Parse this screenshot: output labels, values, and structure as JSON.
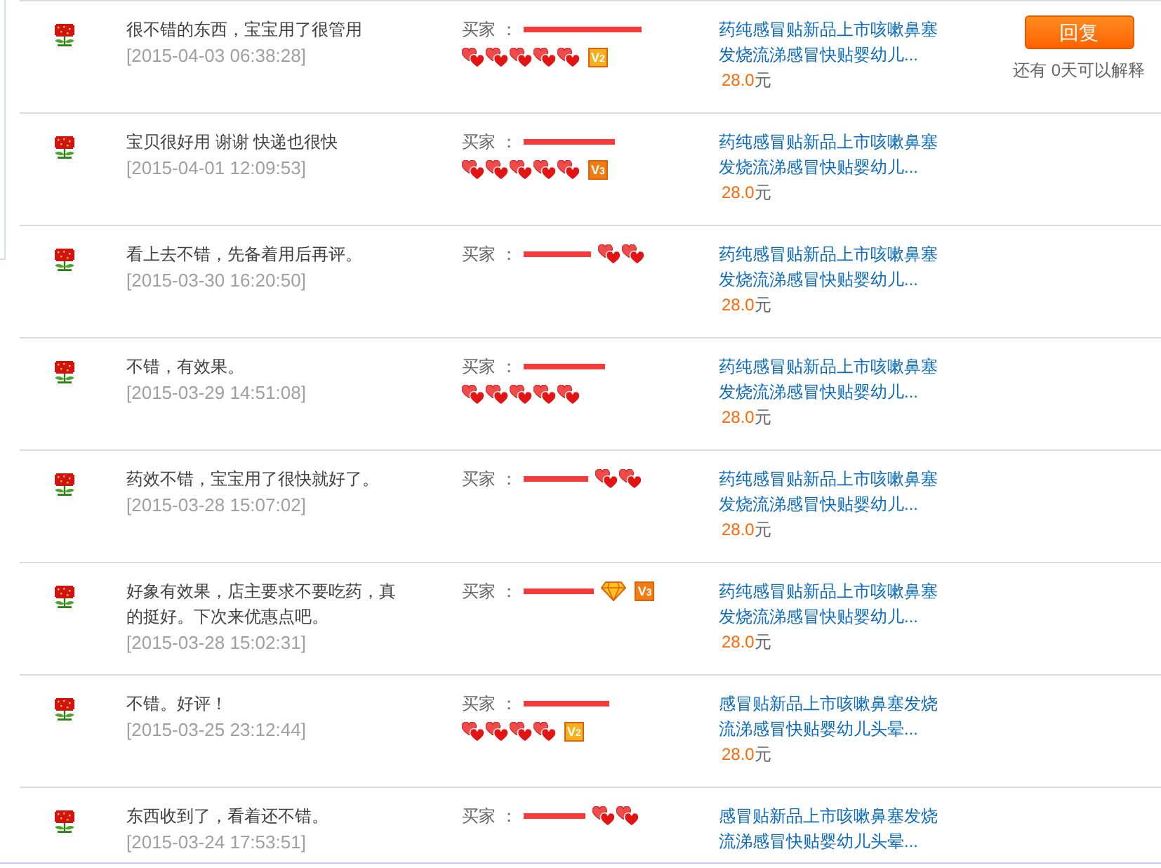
{
  "reviews": [
    {
      "comment": "很不错的东西，宝宝用了很管用",
      "date": "[2015-04-03 06:38:28]",
      "buyer_label": "买家 ：",
      "badges": [
        {
          "kind": "heart"
        },
        {
          "kind": "heart"
        },
        {
          "kind": "heart"
        },
        {
          "kind": "heart"
        },
        {
          "kind": "heart"
        }
      ],
      "vip": {
        "label": "V$_{2}$",
        "color": "#f6b01e"
      },
      "product": "药纯感冒贴新品上市咳嗽鼻塞发烧流涕感冒快贴婴幼儿...",
      "price": "28.0",
      "currency": "元",
      "reply": {
        "button": "回复",
        "note": "还有 0天可以解释"
      }
    },
    {
      "comment": "宝贝很好用 谢谢 快递也很快",
      "date": "[2015-04-01 12:09:53]",
      "buyer_label": "买家 ：",
      "badges": [
        {
          "kind": "heart"
        },
        {
          "kind": "heart"
        },
        {
          "kind": "heart"
        },
        {
          "kind": "heart"
        },
        {
          "kind": "heart"
        }
      ],
      "vip": {
        "label": "V$_{3}$",
        "color": "#f07c12"
      },
      "product": "药纯感冒贴新品上市咳嗽鼻塞发烧流涕感冒快贴婴幼儿...",
      "price": "28.0",
      "currency": "元"
    },
    {
      "comment": "看上去不错，先备着用后再评。",
      "date": "[2015-03-30 16:20:50]",
      "buyer_label": "买家 ：",
      "badges": [
        {
          "kind": "heart"
        },
        {
          "kind": "heart"
        }
      ],
      "product": "药纯感冒贴新品上市咳嗽鼻塞发烧流涕感冒快贴婴幼儿...",
      "price": "28.0",
      "currency": "元"
    },
    {
      "comment": "不错，有效果。",
      "date": "[2015-03-29 14:51:08]",
      "buyer_label": "买家 ：",
      "badges": [
        {
          "kind": "heart"
        },
        {
          "kind": "heart"
        },
        {
          "kind": "heart"
        },
        {
          "kind": "heart"
        },
        {
          "kind": "heart"
        }
      ],
      "product": "药纯感冒贴新品上市咳嗽鼻塞发烧流涕感冒快贴婴幼儿...",
      "price": "28.0",
      "currency": "元"
    },
    {
      "comment": "药效不错，宝宝用了很快就好了。",
      "date": "[2015-03-28 15:07:02]",
      "buyer_label": "买家 ：",
      "badges": [
        {
          "kind": "heart"
        },
        {
          "kind": "heart"
        }
      ],
      "product": "药纯感冒贴新品上市咳嗽鼻塞发烧流涕感冒快贴婴幼儿...",
      "price": "28.0",
      "currency": "元"
    },
    {
      "comment": "好象有效果，店主要求不要吃药，真的挺好。下次来优惠点吧。",
      "date": "[2015-03-28 15:02:31]",
      "buyer_label": "买家 ：",
      "badges": [
        {
          "kind": "diamond"
        }
      ],
      "vip": {
        "label": "V$_{3}$",
        "color": "#f07c12"
      },
      "product": "药纯感冒贴新品上市咳嗽鼻塞发烧流涕感冒快贴婴幼儿...",
      "price": "28.0",
      "currency": "元"
    },
    {
      "comment": "不错。好评！",
      "date": "[2015-03-25 23:12:44]",
      "buyer_label": "买家 ：",
      "badges": [
        {
          "kind": "heart"
        },
        {
          "kind": "heart"
        },
        {
          "kind": "heart"
        },
        {
          "kind": "heart"
        }
      ],
      "vip": {
        "label": "V$_{2}$",
        "color": "#f6b01e"
      },
      "product": "感冒贴新品上市咳嗽鼻塞发烧流涕感冒快贴婴幼儿头晕...",
      "price": "28.0",
      "currency": "元"
    },
    {
      "comment": "东西收到了，看着还不错。",
      "date": "[2015-03-24 17:53:51]",
      "buyer_label": "买家 ：",
      "badges": [
        {
          "kind": "heart"
        },
        {
          "kind": "heart"
        }
      ],
      "product": "感冒贴新品上市咳嗽鼻塞发烧流涕感冒快贴婴幼儿头晕..."
    }
  ]
}
